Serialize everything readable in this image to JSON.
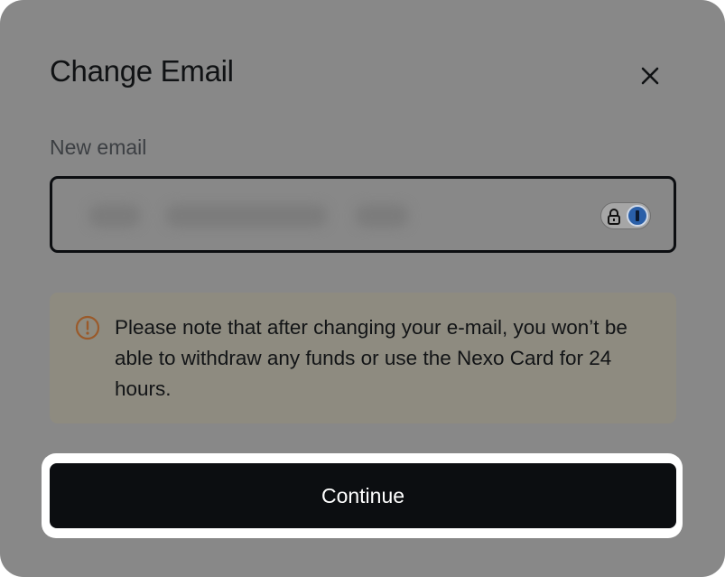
{
  "dialog": {
    "title": "Change Email",
    "close_icon": "close-icon"
  },
  "email_field": {
    "label": "New email",
    "value": "",
    "value_note": "blurred / redacted",
    "password_manager_icons": [
      "lock-icon",
      "password-manager-icon"
    ]
  },
  "notice": {
    "icon": "warning-circle-icon",
    "text": "Please note that after changing your e-mail, you won’t be able to withdraw any funds or use the Nexo Card for 24 hours."
  },
  "actions": {
    "continue_label": "Continue"
  },
  "colors": {
    "overlay_background": "#888888",
    "primary_button": "#0c0e11",
    "notice_background": "#8e8b80",
    "warning_icon": "#9a5a2a",
    "focus_ring": "#ffffff"
  }
}
